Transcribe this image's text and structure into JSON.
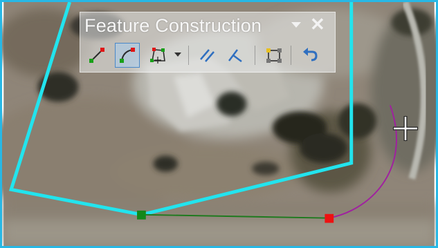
{
  "toolbar": {
    "title": "Feature Construction",
    "tools": [
      {
        "name": "line-tool",
        "active": false
      },
      {
        "name": "arc-tool",
        "active": true
      },
      {
        "name": "polygon-tool",
        "active": false
      },
      {
        "name": "parallel-tool",
        "active": false
      },
      {
        "name": "perpendicular-tool",
        "active": false
      },
      {
        "name": "snap-tool",
        "active": false
      },
      {
        "name": "undo-tool",
        "active": false
      }
    ]
  },
  "colors": {
    "frame": "#27b8e6",
    "boundary": "#22e4ee",
    "segment": "#1e7a1e",
    "arc": "#a020a0",
    "vertex_start": "#13881a",
    "vertex_end": "#ee1111"
  }
}
